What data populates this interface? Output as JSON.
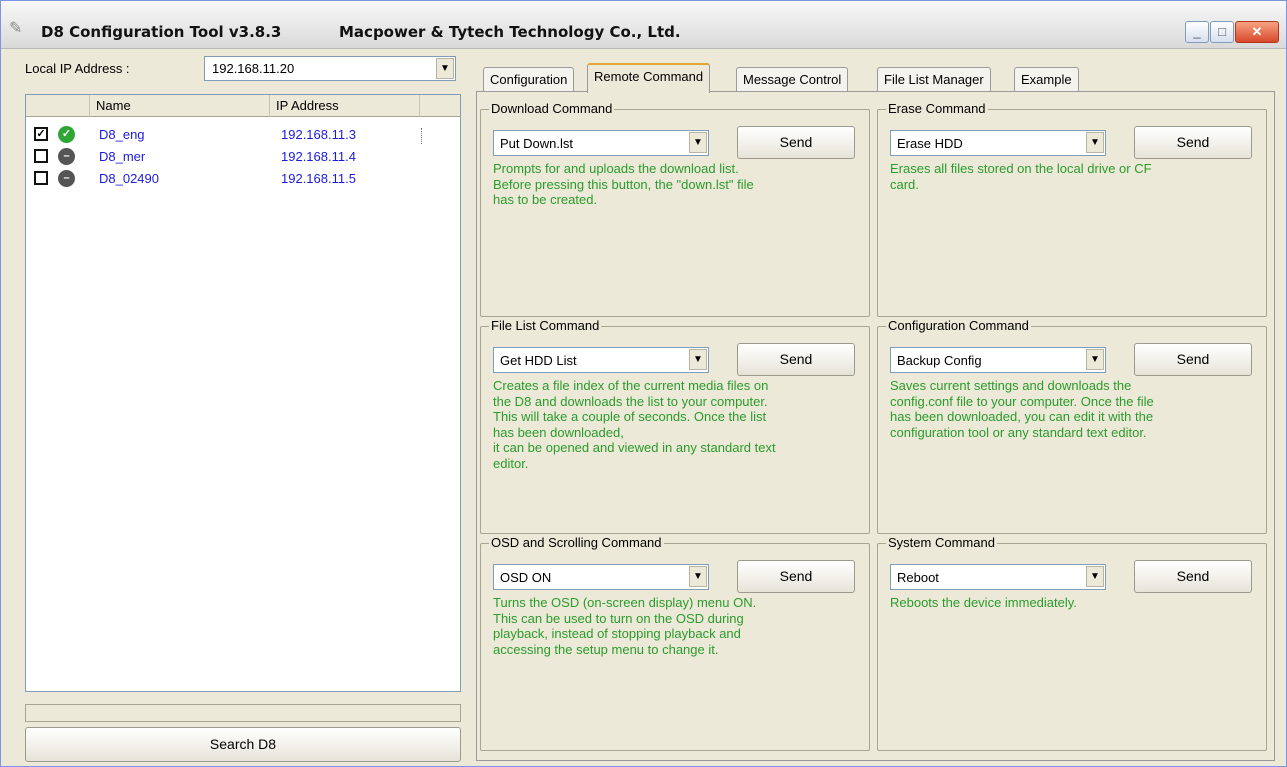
{
  "window": {
    "title": "D8 Configuration Tool v3.8.3",
    "company": "Macpower & Tytech Technology Co., Ltd.",
    "min_glyph": "_",
    "max_glyph": "□",
    "close_glyph": "✕"
  },
  "left": {
    "ip_label": "Local IP Address :",
    "ip_value": "192.168.11.20",
    "columns": [
      "Name",
      "IP Address"
    ],
    "devices": [
      {
        "checked": "✓",
        "status": "✓",
        "name": "D8_eng",
        "ip": "192.168.11.3"
      },
      {
        "checked": "",
        "status": "–",
        "name": "D8_mer",
        "ip": "192.168.11.4"
      },
      {
        "checked": "",
        "status": "–",
        "name": "D8_02490",
        "ip": "192.168.11.5"
      }
    ],
    "search_label": "Search D8"
  },
  "tabs": [
    "Configuration",
    "Remote Command",
    "Message Control",
    "File List Manager",
    "Example"
  ],
  "groups": {
    "download": {
      "title": "Download Command",
      "selected": "Put Down.lst",
      "send": "Send",
      "desc": [
        "Prompts for and uploads the download list.",
        "Before pressing this button, the \"down.lst\" file",
        "has to be created."
      ]
    },
    "erase": {
      "title": "Erase Command",
      "selected": "Erase HDD",
      "send": "Send",
      "desc": [
        "Erases all files stored on the local drive or CF",
        "card."
      ]
    },
    "filelist": {
      "title": "File List Command",
      "selected": "Get HDD List",
      "send": "Send",
      "desc": [
        "Creates a file index of the current media files on",
        "the D8 and downloads the list to your computer.",
        "This will take a couple of seconds. Once the list",
        "has been downloaded,",
        "it can be opened and viewed in any standard text",
        "editor."
      ]
    },
    "config": {
      "title": "Configuration Command",
      "selected": "Backup Config",
      "send": "Send",
      "desc": [
        "Saves current settings and downloads the",
        "config.conf file to your computer. Once the file",
        "has been downloaded, you can edit it with the",
        "configuration tool or any standard text editor."
      ]
    },
    "osd": {
      "title": "OSD and Scrolling Command",
      "selected": "OSD ON",
      "send": "Send",
      "desc": [
        "Turns the OSD (on-screen display) menu ON.",
        "This can be used to turn on the OSD during",
        "playback, instead of stopping playback and",
        "accessing the setup menu to change it."
      ]
    },
    "system": {
      "title": "System Command",
      "selected": "Reboot",
      "send": "Send",
      "desc": [
        "Reboots the device immediately."
      ]
    }
  },
  "colors": {
    "device_text": "#1a1ae0",
    "desc_text": "#2b9b2b",
    "status_ok": "#2fa536",
    "status_off": "#555555"
  }
}
